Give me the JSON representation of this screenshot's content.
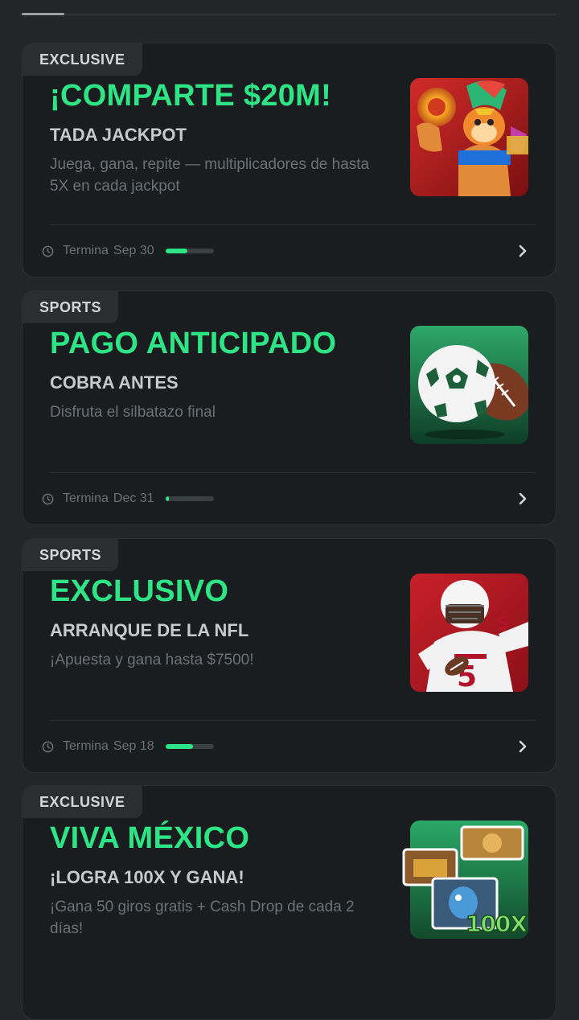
{
  "cards": [
    {
      "tag": "EXCLUSIVE",
      "title": "¡COMPARTE $20M!",
      "subtitle": "TADA JACKPOT",
      "description": "Juega, gana, repite — multiplicadores de hasta 5X en cada jackpot",
      "end_label": "Termina",
      "end_date": "Sep 30",
      "progress": 0.45,
      "image": "aztec-warrior-slot-art"
    },
    {
      "tag": "SPORTS",
      "title": "PAGO ANTICIPADO",
      "subtitle": "COBRA ANTES",
      "description": "Disfruta el silbatazo final",
      "end_label": "Termina",
      "end_date": "Dec 31",
      "progress": 0.08,
      "image": "soccer-and-football-balls"
    },
    {
      "tag": "SPORTS",
      "title": "EXCLUSIVO",
      "subtitle": "ARRANQUE DE LA NFL",
      "description": "¡Apuesta y gana hasta $7500!",
      "end_label": "Termina",
      "end_date": "Sep 18",
      "progress": 0.58,
      "image": "nfl-player-cardinals"
    },
    {
      "tag": "EXCLUSIVE",
      "title": "VIVA MÉXICO",
      "subtitle": "¡LOGRA 100X Y GANA!",
      "description": "¡Gana 50 giros gratis + Cash Drop de cada 2 días!",
      "end_label": "",
      "end_date": "",
      "progress": null,
      "image": "slot-games-collage-100x",
      "image_label": "100X"
    }
  ],
  "colors": {
    "accent": "#2ee585",
    "card_bg": "#1a1d1f",
    "page_bg": "#222628"
  },
  "icons": [
    "clock-icon",
    "chevron-right-icon"
  ]
}
